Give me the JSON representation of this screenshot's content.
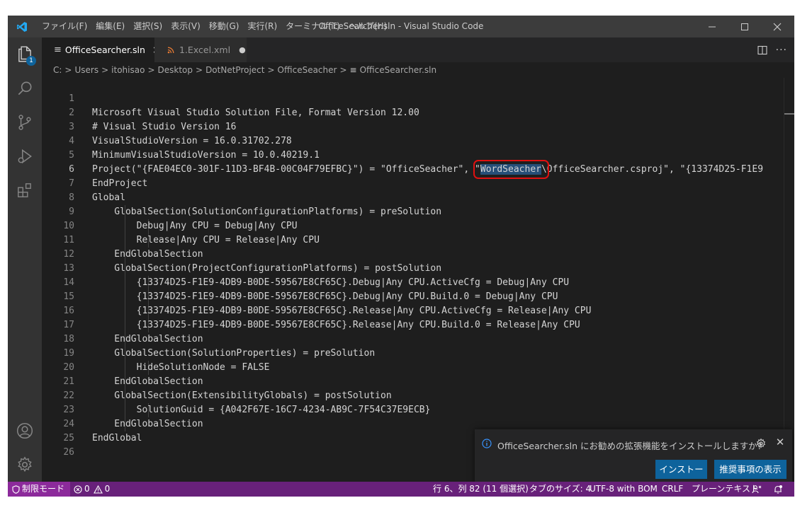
{
  "window": {
    "title": "OfficeSearcher.sln - Visual Studio Code",
    "menus": [
      "ファイル(F)",
      "編集(E)",
      "選択(S)",
      "表示(V)",
      "移動(G)",
      "実行(R)",
      "ターミナル(T)",
      "ヘルプ(H)"
    ]
  },
  "activity_bar": {
    "items": [
      "files-icon",
      "search-icon",
      "source-control-icon",
      "run-debug-icon",
      "extensions-icon"
    ],
    "explorer_badge": "1",
    "bottom": [
      "account-icon",
      "settings-gear-icon"
    ]
  },
  "tabs": [
    {
      "label": "OfficeSearcher.sln",
      "active": true,
      "icon": "text-file-icon",
      "close": "×"
    },
    {
      "label": "1.Excel.xml",
      "active": false,
      "icon": "rss-xml-icon",
      "dirty": "●"
    }
  ],
  "breadcrumb": {
    "segments": [
      "C:",
      "Users",
      "itohisao",
      "Desktop",
      "DotNetProject",
      "OfficeSeacher"
    ],
    "file": "OfficeSearcher.sln",
    "separator": ">"
  },
  "editor": {
    "lines": [
      {
        "n": "1",
        "text": ""
      },
      {
        "n": "2",
        "text": "Microsoft Visual Studio Solution File, Format Version 12.00"
      },
      {
        "n": "3",
        "text": "# Visual Studio Version 16"
      },
      {
        "n": "4",
        "text": "VisualStudioVersion = 16.0.31702.278"
      },
      {
        "n": "5",
        "text": "MinimumVisualStudioVersion = 10.0.40219.1"
      },
      {
        "n": "6",
        "before": "Project(\"{FAE04EC0-301F-11D3-BF4B-00C04F79EFBC}\") = \"OfficeSeacher\", \"",
        "selected": "WordSeacher",
        "after": "\\OfficeSearcher.csproj\", \"{13374D25-F1E9"
      },
      {
        "n": "7",
        "text": "EndProject"
      },
      {
        "n": "8",
        "text": "Global"
      },
      {
        "n": "9",
        "text": "    GlobalSection(SolutionConfigurationPlatforms) = preSolution"
      },
      {
        "n": "10",
        "text": "        Debug|Any CPU = Debug|Any CPU"
      },
      {
        "n": "11",
        "text": "        Release|Any CPU = Release|Any CPU"
      },
      {
        "n": "12",
        "text": "    EndGlobalSection"
      },
      {
        "n": "13",
        "text": "    GlobalSection(ProjectConfigurationPlatforms) = postSolution"
      },
      {
        "n": "14",
        "text": "        {13374D25-F1E9-4DB9-B0DE-59567E8CF65C}.Debug|Any CPU.ActiveCfg = Debug|Any CPU"
      },
      {
        "n": "15",
        "text": "        {13374D25-F1E9-4DB9-B0DE-59567E8CF65C}.Debug|Any CPU.Build.0 = Debug|Any CPU"
      },
      {
        "n": "16",
        "text": "        {13374D25-F1E9-4DB9-B0DE-59567E8CF65C}.Release|Any CPU.ActiveCfg = Release|Any CPU"
      },
      {
        "n": "17",
        "text": "        {13374D25-F1E9-4DB9-B0DE-59567E8CF65C}.Release|Any CPU.Build.0 = Release|Any CPU"
      },
      {
        "n": "18",
        "text": "    EndGlobalSection"
      },
      {
        "n": "19",
        "text": "    GlobalSection(SolutionProperties) = preSolution"
      },
      {
        "n": "20",
        "text": "        HideSolutionNode = FALSE"
      },
      {
        "n": "21",
        "text": "    EndGlobalSection"
      },
      {
        "n": "22",
        "text": "    GlobalSection(ExtensibilityGlobals) = postSolution"
      },
      {
        "n": "23",
        "text": "        SolutionGuid = {A042F67E-16C7-4234-AB9C-7F54C37E9ECB}"
      },
      {
        "n": "24",
        "text": "    EndGlobalSection"
      },
      {
        "n": "25",
        "text": "EndGlobal"
      },
      {
        "n": "26",
        "text": ""
      }
    ],
    "current_line": "6"
  },
  "notification": {
    "message": "OfficeSearcher.sln にお勧めの拡張機能をインストールしますか?",
    "install_label": "インストール",
    "show_label": "推奨事項の表示"
  },
  "status_bar": {
    "restricted_mode": "制限モード",
    "errors": "0",
    "warnings": "0",
    "position": "行 6、列 82 (11 個選択)",
    "tab_size": "タブのサイズ: 4",
    "encoding": "UTF-8 with BOM",
    "eol": "CRLF",
    "language": "プレーンテキスト"
  },
  "colors": {
    "status_bar": "#68217a",
    "selection": "#264f78",
    "highlight_box": "#e01010",
    "button": "#0e639c"
  }
}
